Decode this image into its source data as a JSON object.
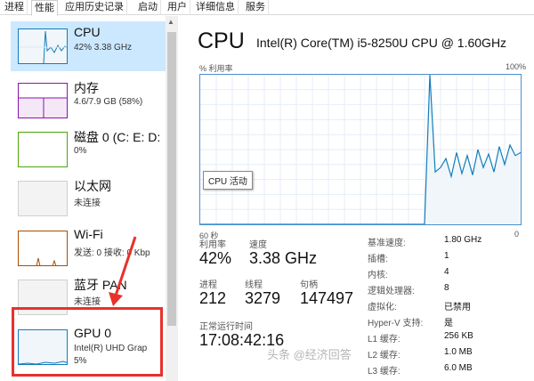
{
  "tabs": [
    "进程",
    "性能",
    "应用历史记录",
    "启动",
    "用户",
    "详细信息",
    "服务"
  ],
  "sidebar": {
    "items": [
      {
        "title": "CPU",
        "sub": "42% 3.38 GHz",
        "sub2": "",
        "color": "#117dbb",
        "selected": true
      },
      {
        "title": "内存",
        "sub": "4.6/7.9 GB (58%)",
        "sub2": "",
        "color": "#8b12ae"
      },
      {
        "title": "磁盘 0 (C: E: D:",
        "sub": "0%",
        "sub2": "",
        "color": "#4da60c"
      },
      {
        "title": "以太网",
        "sub": "未连接",
        "sub2": "",
        "color": "#a74f01"
      },
      {
        "title": "Wi-Fi",
        "sub": "发送: 0 接收: 0 Kbp",
        "sub2": "",
        "color": "#a74f01"
      },
      {
        "title": "蓝牙 PAN",
        "sub": "未连接",
        "sub2": "",
        "color": "#a74f01"
      },
      {
        "title": "GPU 0",
        "sub": "Intel(R) UHD Grap",
        "sub2": "5%",
        "color": "#117dbb"
      }
    ]
  },
  "main": {
    "heading": "CPU",
    "model": "Intel(R) Core(TM) i5-8250U CPU @ 1.60GHz",
    "util_label": "% 利用率",
    "max_label": "100%",
    "time_label": "60 秒",
    "min_label": "0",
    "tooltip": "CPU 活动",
    "stats": {
      "util_label": "利用率",
      "util_value": "42%",
      "speed_label": "速度",
      "speed_value": "3.38 GHz",
      "proc_label": "进程",
      "proc_value": "212",
      "thread_label": "线程",
      "thread_value": "3279",
      "handle_label": "句柄",
      "handle_value": "147497",
      "uptime_label": "正常运行时间",
      "uptime_value": "17:08:42:16"
    },
    "specs": [
      {
        "key": "基准速度:",
        "value": "1.80 GHz"
      },
      {
        "key": "插槽:",
        "value": "1"
      },
      {
        "key": "内核:",
        "value": "4"
      },
      {
        "key": "逻辑处理器:",
        "value": "8"
      },
      {
        "key": "虚拟化:",
        "value": "已禁用"
      },
      {
        "key": "Hyper-V 支持:",
        "value": "是"
      },
      {
        "key": "L1 缓存:",
        "value": "256 KB"
      },
      {
        "key": "L2 缓存:",
        "value": "1.0 MB"
      },
      {
        "key": "L3 缓存:",
        "value": "6.0 MB"
      }
    ],
    "cpu_history": [
      0,
      0,
      0,
      0,
      0,
      0,
      0,
      0,
      0,
      0,
      0,
      0,
      0,
      0,
      0,
      0,
      0,
      0,
      0,
      0,
      0,
      0,
      0,
      0,
      0,
      0,
      0,
      0,
      0,
      0,
      0,
      0,
      0,
      0,
      0,
      0,
      0,
      0,
      0,
      0,
      0,
      0,
      0,
      100,
      35,
      38,
      44,
      32,
      48,
      34,
      46,
      33,
      50,
      38,
      47,
      35,
      52,
      40,
      53,
      46,
      48
    ],
    "accent": "#117dbb",
    "graph_fill": "#f1f6fa"
  },
  "watermark": "头条 @经济回答"
}
